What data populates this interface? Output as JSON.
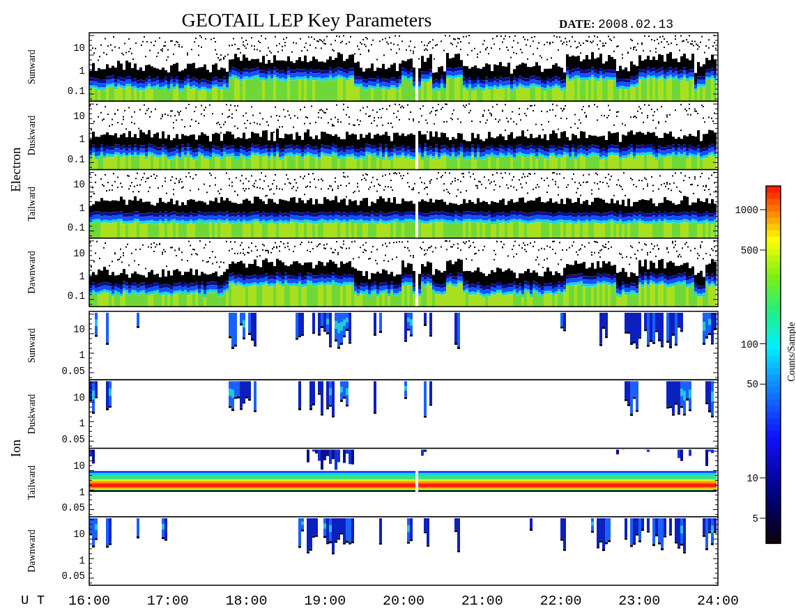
{
  "title": "GEOTAIL LEP Key Parameters",
  "date_label": "DATE:",
  "date": "2008.02.13",
  "groups": [
    {
      "label": "Electron",
      "kind": "electron",
      "panels": [
        {
          "label": "Sunward",
          "yticks": [
            "10",
            "1",
            "0.1"
          ]
        },
        {
          "label": "Duskward",
          "yticks": [
            "10",
            "1",
            "0.1"
          ]
        },
        {
          "label": "Tailward",
          "yticks": [
            "10",
            "1",
            "0.1"
          ]
        },
        {
          "label": "Dawnward",
          "yticks": [
            "10",
            "1",
            "0.1"
          ]
        }
      ]
    },
    {
      "label": "Ion",
      "kind": "ion",
      "panels": [
        {
          "label": "Sunward",
          "yticks": [
            "10",
            "1",
            "0.05"
          ]
        },
        {
          "label": "Duskward",
          "yticks": [
            "10",
            "1",
            "0.05"
          ]
        },
        {
          "label": "Tailward",
          "yticks": [
            "10",
            "1",
            "0.05"
          ]
        },
        {
          "label": "Dawnward",
          "yticks": [
            "10",
            "1",
            "0.05"
          ]
        }
      ]
    }
  ],
  "time_axis": {
    "label": "U T",
    "ticks": [
      "16:00",
      "17:00",
      "18:00",
      "19:00",
      "20:00",
      "21:00",
      "22:00",
      "23:00",
      "24:00"
    ]
  },
  "colorbar": {
    "label": "Counts/Sample",
    "ticks": [
      "1000",
      "500",
      "100",
      "50",
      "10",
      "5"
    ]
  }
}
